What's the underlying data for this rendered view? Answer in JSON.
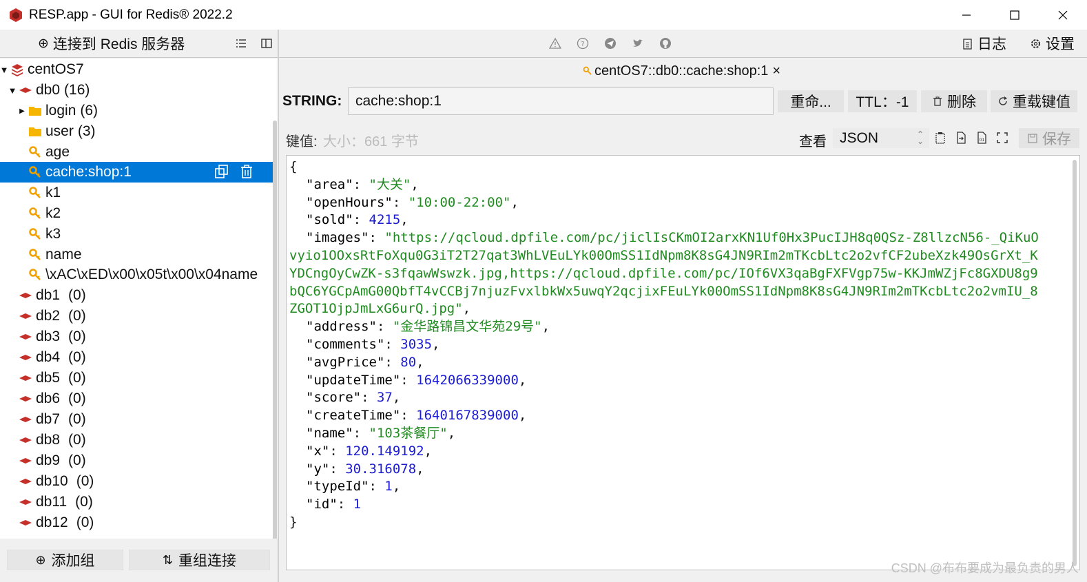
{
  "window": {
    "title": "RESP.app - GUI for Redis® 2022.2",
    "app_icon": "redis-cube-icon",
    "controls": [
      "minimize-icon",
      "maximize-icon",
      "close-icon"
    ]
  },
  "toolbar": {
    "connect_label": "连接到 Redis 服务器",
    "connect_icon": "plus-circle-icon",
    "left_icons": [
      "list-icon",
      "panel-icon"
    ],
    "center_icons": [
      "warning-icon",
      "help-icon",
      "telegram-icon",
      "twitter-icon",
      "github-icon"
    ],
    "log_label": "日志",
    "settings_label": "设置"
  },
  "tree": {
    "connection": "centOS7",
    "db0": {
      "label": "db0",
      "count": "(16)"
    },
    "folders": [
      {
        "label": "login",
        "count": "(6)"
      },
      {
        "label": "user",
        "count": "(3)"
      }
    ],
    "keys": [
      "age",
      "cache:shop:1",
      "k1",
      "k2",
      "k3",
      "name",
      "\\xAC\\xED\\x00\\x05t\\x00\\x04name"
    ],
    "selected_key": "cache:shop:1",
    "dbs": [
      {
        "label": "db1",
        "count": "(0)"
      },
      {
        "label": "db2",
        "count": "(0)"
      },
      {
        "label": "db3",
        "count": "(0)"
      },
      {
        "label": "db4",
        "count": "(0)"
      },
      {
        "label": "db5",
        "count": "(0)"
      },
      {
        "label": "db6",
        "count": "(0)"
      },
      {
        "label": "db7",
        "count": "(0)"
      },
      {
        "label": "db8",
        "count": "(0)"
      },
      {
        "label": "db9",
        "count": "(0)"
      },
      {
        "label": "db10",
        "count": "(0)"
      },
      {
        "label": "db11",
        "count": "(0)"
      },
      {
        "label": "db12",
        "count": "(0)"
      }
    ]
  },
  "sidebar_buttons": {
    "add_group": "添加组",
    "regroup": "重组连接"
  },
  "tab": {
    "label": "centOS7::db0::cache:shop:1",
    "close": "×"
  },
  "key_view": {
    "type": "STRING:",
    "key_name": "cache:shop:1",
    "rename": "重命...",
    "ttl": "TTL：-1",
    "delete": "删除",
    "reload": "重载键值",
    "value_label": "键值:",
    "size_text": "大小：661 字节",
    "view_label": "查看",
    "view_mode": "JSON",
    "save": "保存"
  },
  "json_value": {
    "area": "\"大关\"",
    "openHours": "\"10:00-22:00\"",
    "sold": "4215",
    "images_lines": [
      "\"https://qcloud.dpfile.com/pc/jiclIsCKmOI2arxKN1Uf0Hx3PucIJH8q0QSz-Z8llzcN56-_QiKuO",
      "vyio1OOxsRtFoXqu0G3iT2T27qat3WhLVEuLYk00OmSS1IdNpm8K8sG4JN9RIm2mTKcbLtc2o2vfCF2ubeXzk49OsGrXt_K",
      "YDCngOyCwZK-s3fqawWswzk.jpg,https://qcloud.dpfile.com/pc/IOf6VX3qaBgFXFVgp75w-KKJmWZjFc8GXDU8g9",
      "bQC6YGCpAmG00QbfT4vCCBj7njuzFvxlbkWx5uwqY2qcjixFEuLYk00OmSS1IdNpm8K8sG4JN9RIm2mTKcbLtc2o2vmIU_8",
      "ZGOT1OjpJmLxG6urQ.jpg\""
    ],
    "address": "\"金华路锦昌文华苑29号\"",
    "comments": "3035",
    "avgPrice": "80",
    "updateTime": "1642066339000",
    "score": "37",
    "createTime": "1640167839000",
    "name": "\"103茶餐厅\"",
    "x": "120.149192",
    "y": "30.316078",
    "typeId": "1",
    "id": "1"
  },
  "watermark": "CSDN @布布要成为最负责的男人"
}
